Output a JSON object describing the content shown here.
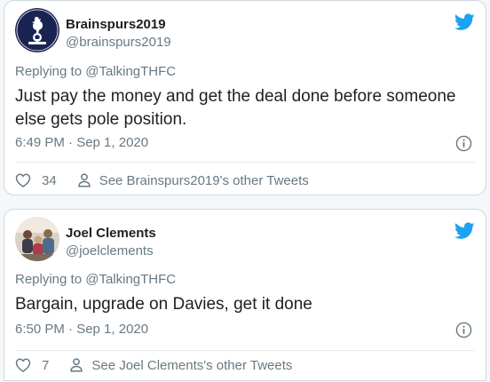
{
  "tweets": [
    {
      "name": "Brainspurs2019",
      "handle": "@brainspurs2019",
      "replying_prefix": "Replying to ",
      "replying_to": "@TalkingTHFC",
      "text": "Just pay the money and get the deal done before someone else gets pole position.",
      "timestamp": "6:49 PM · Sep 1, 2020",
      "likes": "34",
      "other_tweets_label": "See Brainspurs2019's other Tweets",
      "avatar_icon": "spurs-cockerel-logo"
    },
    {
      "name": "Joel Clements",
      "handle": "@joelclements",
      "replying_prefix": "Replying to ",
      "replying_to": "@TalkingTHFC",
      "text": "Bargain, upgrade on Davies, get it done",
      "timestamp": "6:50 PM · Sep 1, 2020",
      "likes": "7",
      "other_tweets_label": "See Joel Clements's other Tweets",
      "avatar_icon": "profile-photo"
    }
  ],
  "colors": {
    "twitter_blue": "#1da1f2",
    "secondary_text": "#697882",
    "primary_text": "#1c2022",
    "border": "#cfd9de"
  }
}
